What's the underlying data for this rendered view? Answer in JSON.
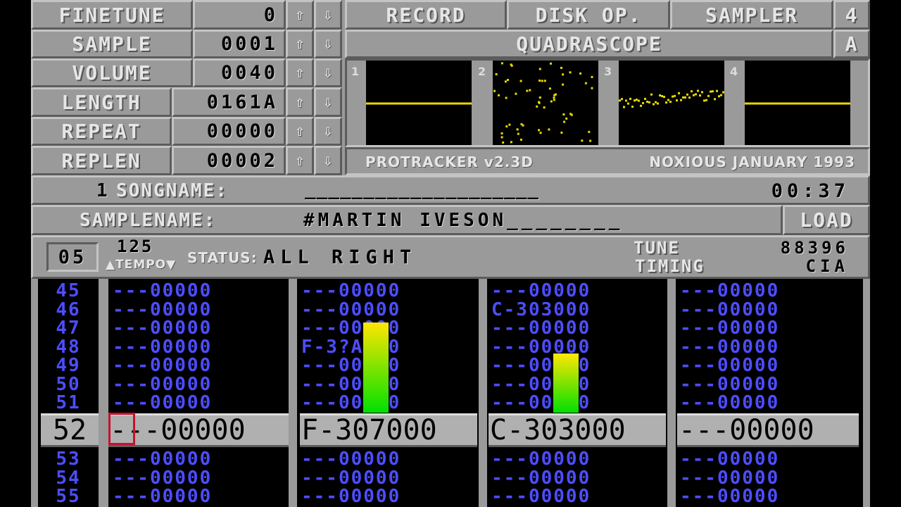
{
  "panel": {
    "finetune_label": "FINETUNE",
    "finetune_value": "0",
    "sample_label": "SAMPLE",
    "sample_value": "0001",
    "volume_label": "VOLUME",
    "volume_value": "0040",
    "length_label": "LENGTH",
    "length_value": "0161A",
    "repeat_label": "REPEAT",
    "repeat_value": "00000",
    "replen_label": "REPLEN",
    "replen_value": "00002",
    "up_glyph": "⇧",
    "down_glyph": "⇩"
  },
  "menu": {
    "record": "RECORD",
    "disk_op": "DISK OP.",
    "sampler": "SAMPLER",
    "num": "4",
    "quadrascope": "QUADRASCOPE",
    "mode": "A"
  },
  "scope": {
    "labels": [
      "1",
      "2",
      "3",
      "4"
    ],
    "color": "#e8d800"
  },
  "credits": {
    "version": "PROTRACKER v2.3D",
    "author": "NOXIOUS JANUARY 1993"
  },
  "song": {
    "num": "1",
    "label": "SONGNAME:",
    "name": "____________________",
    "time": "00:37"
  },
  "samplename": {
    "label": "SAMPLENAME:",
    "name": "#MARTIN IVESON________",
    "load": "LOAD"
  },
  "status": {
    "position": "05",
    "tempo_value": "125",
    "tempo_label": "▲TEMPO▼",
    "status_label": "STATUS:",
    "status_text": "ALL RIGHT",
    "tune_label": "TUNE",
    "timing_label": "TIMING",
    "tune_value": "88396",
    "timing_value": "CIA"
  },
  "pattern": {
    "row_numbers_above": [
      "45",
      "46",
      "47",
      "48",
      "49",
      "50",
      "51"
    ],
    "current_row": "52",
    "row_numbers_below": [
      "53",
      "54",
      "55"
    ],
    "channels": [
      {
        "above": [
          "---00000",
          "---00000",
          "---00000",
          "---00000",
          "---00000",
          "---00000",
          "---00000"
        ],
        "current": "---00000",
        "below": [
          "---00000",
          "---00000",
          "---00000"
        ]
      },
      {
        "above": [
          "---00000",
          "---00000",
          "---00000",
          "F-3?A000",
          "---00000",
          "---00000",
          "---00000"
        ],
        "current": "F-307000",
        "below": [
          "---00000",
          "---00000",
          "---00000"
        ]
      },
      {
        "above": [
          "---00000",
          "C-303000",
          "---00000",
          "---00000",
          "---00000",
          "---00000",
          "---00000"
        ],
        "current": "C-303000",
        "below": [
          "---00000",
          "---00000",
          "---00000"
        ]
      },
      {
        "above": [
          "---00000",
          "---00000",
          "---00000",
          "---00000",
          "---00000",
          "---00000",
          "---00000"
        ],
        "current": "---00000",
        "below": [
          "---00000",
          "---00000",
          "---00000"
        ]
      }
    ],
    "vu_levels": [
      0,
      1.0,
      0.66,
      0
    ],
    "note_color": "#4d4dff",
    "vu_colors": [
      "#ffe600",
      "#00e000"
    ]
  }
}
